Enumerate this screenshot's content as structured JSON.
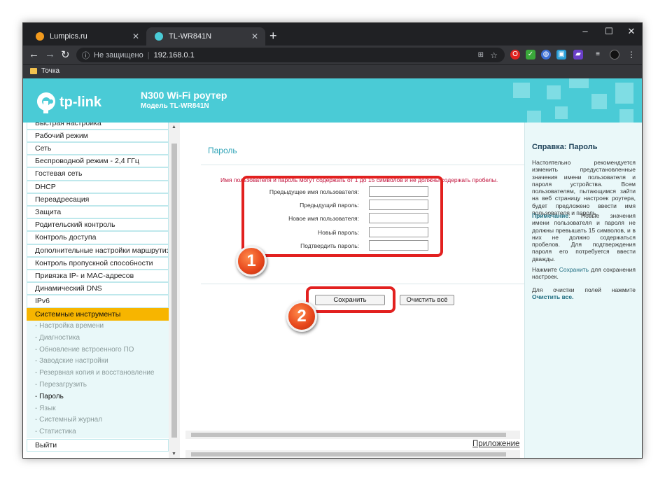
{
  "browser": {
    "tabs": [
      {
        "title": "Lumpics.ru",
        "active": false
      },
      {
        "title": "TL-WR841N",
        "active": true
      }
    ],
    "new_tab": "+",
    "window_controls": {
      "minimize": "–",
      "maximize": "☐",
      "close": "✕"
    },
    "nav": {
      "back": "←",
      "forward": "→",
      "reload": "↻"
    },
    "address": {
      "security": "Не защищено",
      "url": "192.168.0.1"
    },
    "bookmarks": [
      {
        "label": "Точка"
      }
    ],
    "colors": {
      "chrome_dark": "#202124",
      "chrome_toolbar": "#35363a"
    }
  },
  "router": {
    "brand": "tp-link",
    "model_title": "N300 Wi-Fi роутер",
    "model_sub": "Модель TL-WR841N",
    "colors": {
      "header": "#4acbd6",
      "active_menu": "#f7b500",
      "title": "#33a5b8",
      "warning": "#c0103a"
    }
  },
  "menu": {
    "items": [
      {
        "label": "Быстрая настройка"
      },
      {
        "label": "Рабочий режим"
      },
      {
        "label": "Сеть"
      },
      {
        "label": "Беспроводной режим - 2,4 ГГц"
      },
      {
        "label": "Гостевая сеть"
      },
      {
        "label": "DHCP"
      },
      {
        "label": "Переадресация"
      },
      {
        "label": "Защита"
      },
      {
        "label": "Родительский контроль"
      },
      {
        "label": "Контроль доступа"
      },
      {
        "label": "Дополнительные настройки маршрутизации"
      },
      {
        "label": "Контроль пропускной способности"
      },
      {
        "label": "Привязка IP- и MAC-адресов"
      },
      {
        "label": "Динамический DNS"
      },
      {
        "label": "IPv6"
      },
      {
        "label": "Системные инструменты"
      }
    ],
    "sub_items": [
      {
        "label": "- Настройка времени"
      },
      {
        "label": "- Диагностика"
      },
      {
        "label": "- Обновление встроенного ПО"
      },
      {
        "label": "- Заводские настройки"
      },
      {
        "label": "- Резервная копия и восстановление"
      },
      {
        "label": "- Перезагрузить"
      },
      {
        "label": "- Пароль"
      },
      {
        "label": "- Язык"
      },
      {
        "label": "- Системный журнал"
      },
      {
        "label": "- Статистика"
      }
    ],
    "logout": "Выйти"
  },
  "main": {
    "title": "Пароль",
    "note": "Имя пользователя и пароль могут содержать от 1 до 15 символов и не должны содержать пробелы.",
    "fields": [
      {
        "label": "Предыдущее имя пользователя:",
        "value": ""
      },
      {
        "label": "Предыдущий пароль:",
        "value": ""
      },
      {
        "label": "Новое имя пользователя:",
        "value": ""
      },
      {
        "label": "Новый пароль:",
        "value": ""
      },
      {
        "label": "Подтвердить пароль:",
        "value": ""
      }
    ],
    "save_button": "Сохранить",
    "clear_button": "Очистить всё",
    "annotations": [
      "1",
      "2"
    ],
    "bottom_link": "Приложение"
  },
  "help": {
    "title": "Справка: Пароль",
    "p1": "Настоятельно рекомендуется изменить предустановленные значения имени пользователя и пароля устройства. Всем пользователям, пытающимся зайти на веб страницу настроек роутера, будет предложено ввести имя пользователя и пароль.",
    "note_label": "Примечание",
    "note_text": ": Новые значения имени пользователя и пароля не должны превышать 15 символов, и в них не должно содержаться пробелов. Для подтверждения пароля его потребуется ввести дважды.",
    "p3_pre": "Нажмите",
    "p3_em": "Сохранить",
    "p3_post": "для сохранения настроек.",
    "p4_pre": "Для очистки полей нажмите",
    "p4_em": "Очистить все."
  }
}
